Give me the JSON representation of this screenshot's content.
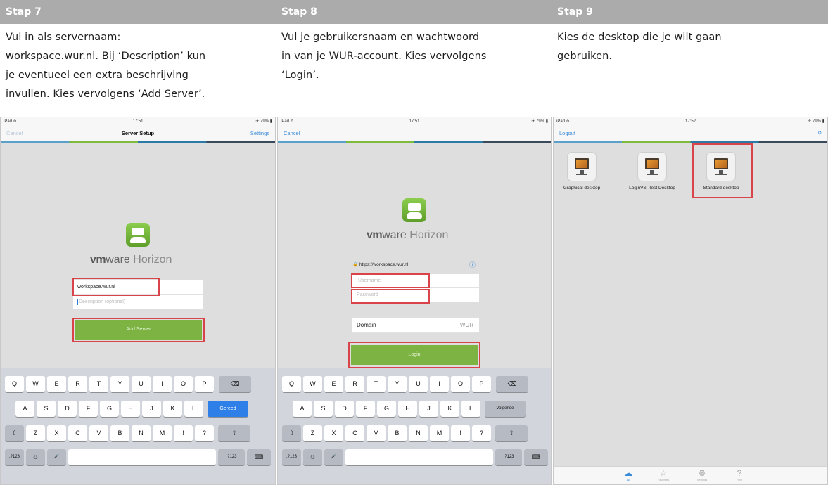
{
  "steps": [
    {
      "title": "Stap 7",
      "lines": [
        "Vul in als servernaam:",
        "workspace.wur.nl. Bij ‘Description’ kun",
        "je eventueel een extra beschrijving",
        "invullen. Kies vervolgens ‘Add Server’."
      ]
    },
    {
      "title": "Stap 8",
      "lines": [
        "Vul je gebruikersnaam en wachtwoord",
        "in van je WUR-account. Kies vervolgens",
        "‘Login’."
      ]
    },
    {
      "title": "Stap 9",
      "lines": [
        "Kies de desktop die je wilt gaan",
        "gebruiken."
      ]
    }
  ],
  "screen1": {
    "status": {
      "left": "iPad ≎",
      "time": "17:51",
      "right": "✈ 79% ▮"
    },
    "nav": {
      "left": "Cancel",
      "title": "Server Setup",
      "right": "Settings"
    },
    "brand": {
      "vm": "vm",
      "ware": "ware",
      "product": "Horizon"
    },
    "server_value": "workspace.wur.nl",
    "description_placeholder": "Description (optional)",
    "add_server": "Add Server",
    "keyboard": {
      "row1": [
        "Q",
        "W",
        "E",
        "R",
        "T",
        "Y",
        "U",
        "I",
        "O",
        "P"
      ],
      "row2": [
        "A",
        "S",
        "D",
        "F",
        "G",
        "H",
        "J",
        "K",
        "L"
      ],
      "row3": [
        "Z",
        "X",
        "C",
        "V",
        "B",
        "N",
        "M",
        "!",
        "?"
      ],
      "return": "Gereed",
      "num": ".?123",
      "backspace": "⌫",
      "shift": "⇧",
      "emoji": "☺",
      "mic": "🎤",
      "hide": "⌨"
    }
  },
  "screen2": {
    "status": {
      "left": "iPad ≎",
      "time": "17:51",
      "right": "✈ 79% ▮"
    },
    "nav": {
      "left": "Cancel"
    },
    "brand": {
      "vm": "vm",
      "ware": "ware",
      "product": "Horizon"
    },
    "server_url": "https://workspace.wur.nl",
    "info": "ⓘ",
    "username_placeholder": "Username",
    "password_placeholder": "Password",
    "domain_label": "Domain",
    "domain_value": "WUR",
    "login": "Login",
    "keyboard": {
      "row1": [
        "Q",
        "W",
        "E",
        "R",
        "T",
        "Y",
        "U",
        "I",
        "O",
        "P"
      ],
      "row2": [
        "A",
        "S",
        "D",
        "F",
        "G",
        "H",
        "J",
        "K",
        "L"
      ],
      "row3": [
        "Z",
        "X",
        "C",
        "V",
        "B",
        "N",
        "M",
        "!",
        "?"
      ],
      "return": "Volgende",
      "num": ".?123",
      "backspace": "⌫",
      "shift": "⇧",
      "emoji": "☺",
      "mic": "🎤",
      "hide": "⌨"
    }
  },
  "screen3": {
    "status": {
      "left": "iPad ≎",
      "time": "17:52",
      "right": "✈ 79% ▮"
    },
    "nav": {
      "left": "Logout",
      "right": "⚲"
    },
    "desktops": [
      "Graphical desktop",
      "LoginVSI Test Desktop",
      "Standard desktop"
    ],
    "tabs": [
      {
        "icon": "☁",
        "label": "All"
      },
      {
        "icon": "☆",
        "label": "Favorites"
      },
      {
        "icon": "⚙",
        "label": "Settings"
      },
      {
        "icon": "?",
        "label": "Help"
      }
    ]
  }
}
